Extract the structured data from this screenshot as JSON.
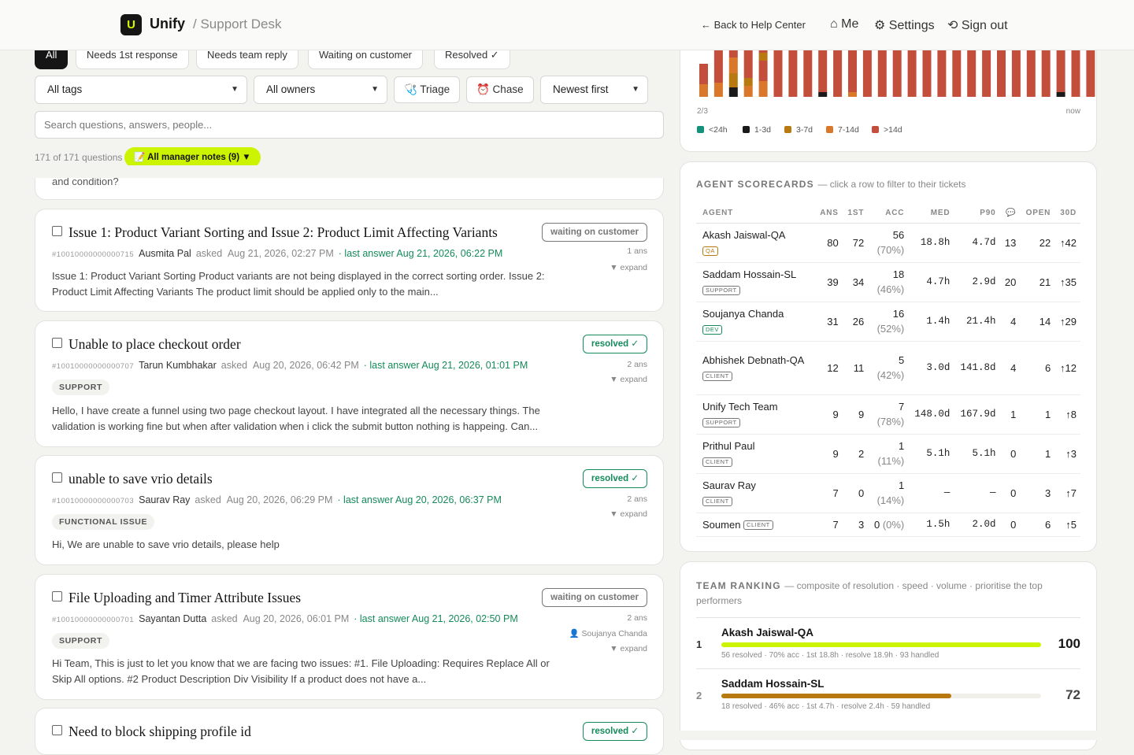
{
  "header": {
    "brand": "Unify",
    "brand_sub": "/ Support Desk",
    "back": "← Back to Help Center",
    "me": "⌂ Me",
    "settings": "⚙ Settings",
    "signout": "⟲ Sign out"
  },
  "filters": {
    "chips": [
      "All",
      "Needs 1st response",
      "Needs team reply",
      "Waiting on customer",
      "Resolved ✓"
    ],
    "tags": "All tags",
    "owners": "All owners",
    "triage": "🩺 Triage",
    "chase": "⏰ Chase",
    "sort": "Newest first",
    "search_placeholder": "Search questions, answers, people...",
    "count": "171 of 171 questions",
    "notes": "📝 All manager notes (9) ▼"
  },
  "partial_card_text": "and condition?",
  "tickets": [
    {
      "title": "Issue 1: Product Variant Sorting and Issue 2: Product Limit Affecting Variants",
      "id": "#10010000000000715",
      "author": "Ausmita Pal",
      "asked": "asked",
      "date": "Aug 21, 2026, 02:27 PM",
      "last": "· last answer Aug 21, 2026, 06:22 PM",
      "status": "waiting on customer",
      "answers": "1 ans",
      "expand": "▼ expand",
      "body": "Issue 1: Product Variant Sorting Product variants are not being displayed in the correct sorting order. Issue 2: Product Limit Affecting Variants The product limit should be applied only to the main..."
    },
    {
      "title": "Unable to place checkout order",
      "id": "#10010000000000707",
      "author": "Tarun Kumbhakar",
      "asked": "asked",
      "date": "Aug 20, 2026, 06:42 PM",
      "last": "· last answer Aug 21, 2026, 01:01 PM",
      "tag": "SUPPORT",
      "status": "resolved ✓",
      "answers": "2 ans",
      "expand": "▼ expand",
      "body": "Hello, I have create a funnel using two page checkout layout. I have integrated all the necessary things. The validation is working fine but when after validation when i click the submit button nothing is happeing. Can..."
    },
    {
      "title": "unable to save vrio details",
      "id": "#10010000000000703",
      "author": "Saurav Ray",
      "asked": "asked",
      "date": "Aug 20, 2026, 06:29 PM",
      "last": "· last answer Aug 20, 2026, 06:37 PM",
      "tag": "FUNCTIONAL ISSUE",
      "status": "resolved ✓",
      "answers": "2 ans",
      "expand": "▼ expand",
      "body": "Hi, We are unable to save vrio details, please help"
    },
    {
      "title": "File Uploading and Timer Attribute Issues",
      "id": "#10010000000000701",
      "author": "Sayantan Dutta",
      "asked": "asked",
      "date": "Aug 20, 2026, 06:01 PM",
      "last": "· last answer Aug 21, 2026, 02:50 PM",
      "tag": "SUPPORT",
      "status": "waiting on customer",
      "answers": "2 ans",
      "assignee": "👤 Soujanya Chanda",
      "expand": "▼ expand",
      "body": "Hi Team, This is just to let you know that we are facing two issues: #1. File Uploading: Requires Replace All or Skip All options. #2 Product Description Div Visibility If a product does not have a..."
    },
    {
      "title": "Need to block shipping profile id",
      "status": "resolved ✓"
    }
  ],
  "aging_chart": {
    "x_start": "2/3",
    "x_end": "now",
    "legend": [
      "<24h",
      "1-3d",
      "3-7d",
      "7-14d",
      ">14d"
    ],
    "colors": [
      "#14917a",
      "#1a1a1a",
      "#b87a10",
      "#d9782a",
      "#c44e3c"
    ]
  },
  "scorecards": {
    "title": "AGENT SCORECARDS",
    "subtitle": "— click a row to filter to their tickets",
    "columns": [
      "AGENT",
      "ANS",
      "1ST",
      "ACC",
      "MED",
      "P90",
      "💬",
      "OPEN",
      "30D"
    ],
    "rows": [
      {
        "name": "Akash Jaiswal-QA",
        "role": "QA",
        "ans": "80",
        "first": "72",
        "acc": "56",
        "pct": "(70%)",
        "med": "18.8h",
        "p90": "4.7d",
        "msgs": "13",
        "open": "22",
        "d30": "↑42"
      },
      {
        "name": "Saddam Hossain-SL",
        "role": "SUPPORT",
        "ans": "39",
        "first": "34",
        "acc": "18",
        "pct": "(46%)",
        "med": "4.7h",
        "p90": "2.9d",
        "msgs": "20",
        "open": "21",
        "d30": "↑35"
      },
      {
        "name": "Soujanya Chanda",
        "role": "DEV",
        "ans": "31",
        "first": "26",
        "acc": "16",
        "pct": "(52%)",
        "med": "1.4h",
        "p90": "21.4h",
        "msgs": "4",
        "open": "14",
        "d30": "↑29"
      },
      {
        "name": "Abhishek Debnath-QA",
        "role": "CLIENT",
        "ans": "12",
        "first": "11",
        "acc": "5",
        "pct": "(42%)",
        "med": "3.0d",
        "p90": "141.8d",
        "msgs": "4",
        "open": "6",
        "d30": "↑12"
      },
      {
        "name": "Unify Tech Team",
        "role": "SUPPORT",
        "ans": "9",
        "first": "9",
        "acc": "7",
        "pct": "(78%)",
        "med": "148.0d",
        "p90": "167.9d",
        "msgs": "1",
        "open": "1",
        "d30": "↑8"
      },
      {
        "name": "Prithul Paul",
        "role": "CLIENT",
        "ans": "9",
        "first": "2",
        "acc": "1",
        "pct": "(11%)",
        "med": "5.1h",
        "p90": "5.1h",
        "msgs": "0",
        "open": "1",
        "d30": "↑3"
      },
      {
        "name": "Saurav Ray",
        "role": "CLIENT",
        "ans": "7",
        "first": "0",
        "acc": "1",
        "pct": "(14%)",
        "med": "—",
        "p90": "—",
        "msgs": "0",
        "open": "3",
        "d30": "↑7"
      },
      {
        "name": "Soumen",
        "role": "CLIENT",
        "ans": "7",
        "first": "3",
        "acc": "0",
        "pct": "(0%)",
        "med": "1.5h",
        "p90": "2.0d",
        "msgs": "0",
        "open": "6",
        "d30": "↑5"
      }
    ]
  },
  "ranking": {
    "title": "TEAM RANKING",
    "subtitle": "— composite of resolution · speed · volume · prioritise the top performers",
    "rows": [
      {
        "rank": "1",
        "name": "Akash Jaiswal-QA",
        "meta": "56 resolved · 70% acc · 1st 18.8h · resolve 18.9h · 93 handled",
        "score": "100",
        "color": "#ccf400"
      },
      {
        "rank": "2",
        "name": "Saddam Hossain-SL",
        "meta": "18 resolved · 46% acc · 1st 4.7h · resolve 2.4h · 59 handled",
        "score": "72",
        "color": "#b87a10"
      }
    ]
  }
}
